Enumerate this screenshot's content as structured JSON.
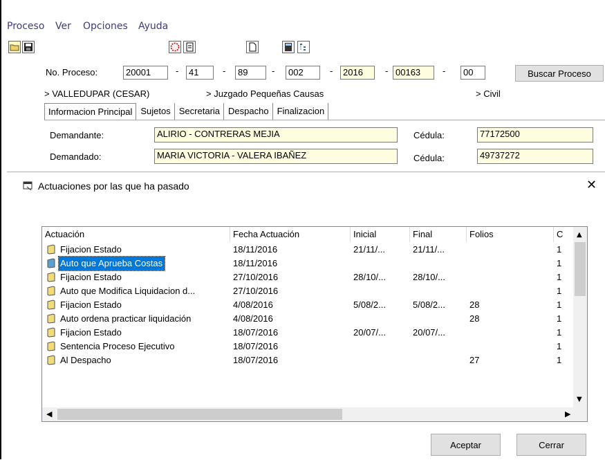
{
  "menu": [
    "Proceso",
    "Ver",
    "Opciones",
    "Ayuda"
  ],
  "process": {
    "label": "No. Proceso:",
    "parts": [
      "20001",
      "41",
      "89",
      "002",
      "2016",
      "00163",
      "00"
    ],
    "search_button": "Buscar Proceso"
  },
  "location": {
    "city": "> VALLEDUPAR (CESAR)",
    "court": "> Juzgado Pequeñas Causas",
    "type": "> Civil"
  },
  "tabs": [
    "Informacion Principal",
    "Sujetos",
    "Secretaria",
    "Despacho",
    "Finalizacion"
  ],
  "parties": {
    "demandante_label": "Demandante:",
    "demandante": "ALIRIO - CONTRERAS MEJIA",
    "demandante_id_label": "Cédula:",
    "demandante_id": "77172500",
    "demandado_label": "Demandado:",
    "demandado": "MARIA VICTORIA - VALERA IBAÑEZ",
    "demandado_id_label": "Cédula:",
    "demandado_id": "49737272"
  },
  "dialog": {
    "title": "Actuaciones por las que ha pasado",
    "columns": [
      "Actuación",
      "Fecha Actuación",
      "Inicial",
      "Final",
      "Folios",
      "C"
    ],
    "rows": [
      {
        "actuacion": "Fijacion Estado",
        "fecha": "18/11/2016",
        "inicial": "21/11/...",
        "final": "21/11/...",
        "folios": "",
        "c": "1"
      },
      {
        "actuacion": "Auto que Aprueba Costas",
        "fecha": "18/11/2016",
        "inicial": "",
        "final": "",
        "folios": "",
        "c": "1"
      },
      {
        "actuacion": "Fijacion Estado",
        "fecha": "27/10/2016",
        "inicial": "28/10/...",
        "final": "28/10/...",
        "folios": "",
        "c": "1"
      },
      {
        "actuacion": "Auto que Modifica Liquidacion d...",
        "fecha": "27/10/2016",
        "inicial": "",
        "final": "",
        "folios": "",
        "c": "1"
      },
      {
        "actuacion": "Fijacion Estado",
        "fecha": "4/08/2016",
        "inicial": "5/08/2...",
        "final": "5/08/2...",
        "folios": "28",
        "c": "1"
      },
      {
        "actuacion": "Auto ordena practicar liquidación",
        "fecha": "4/08/2016",
        "inicial": "",
        "final": "",
        "folios": "28",
        "c": "1"
      },
      {
        "actuacion": "Fijacion Estado",
        "fecha": "18/07/2016",
        "inicial": "20/07/...",
        "final": "20/07/...",
        "folios": "",
        "c": "1"
      },
      {
        "actuacion": "Sentencia Proceso Ejecutivo",
        "fecha": "18/07/2016",
        "inicial": "",
        "final": "",
        "folios": "",
        "c": "1"
      },
      {
        "actuacion": "Al Despacho",
        "fecha": "18/07/2016",
        "inicial": "",
        "final": "",
        "folios": "27",
        "c": "1"
      }
    ],
    "selected_index": 1,
    "accept_button": "Aceptar",
    "close_button": "Cerrar"
  }
}
